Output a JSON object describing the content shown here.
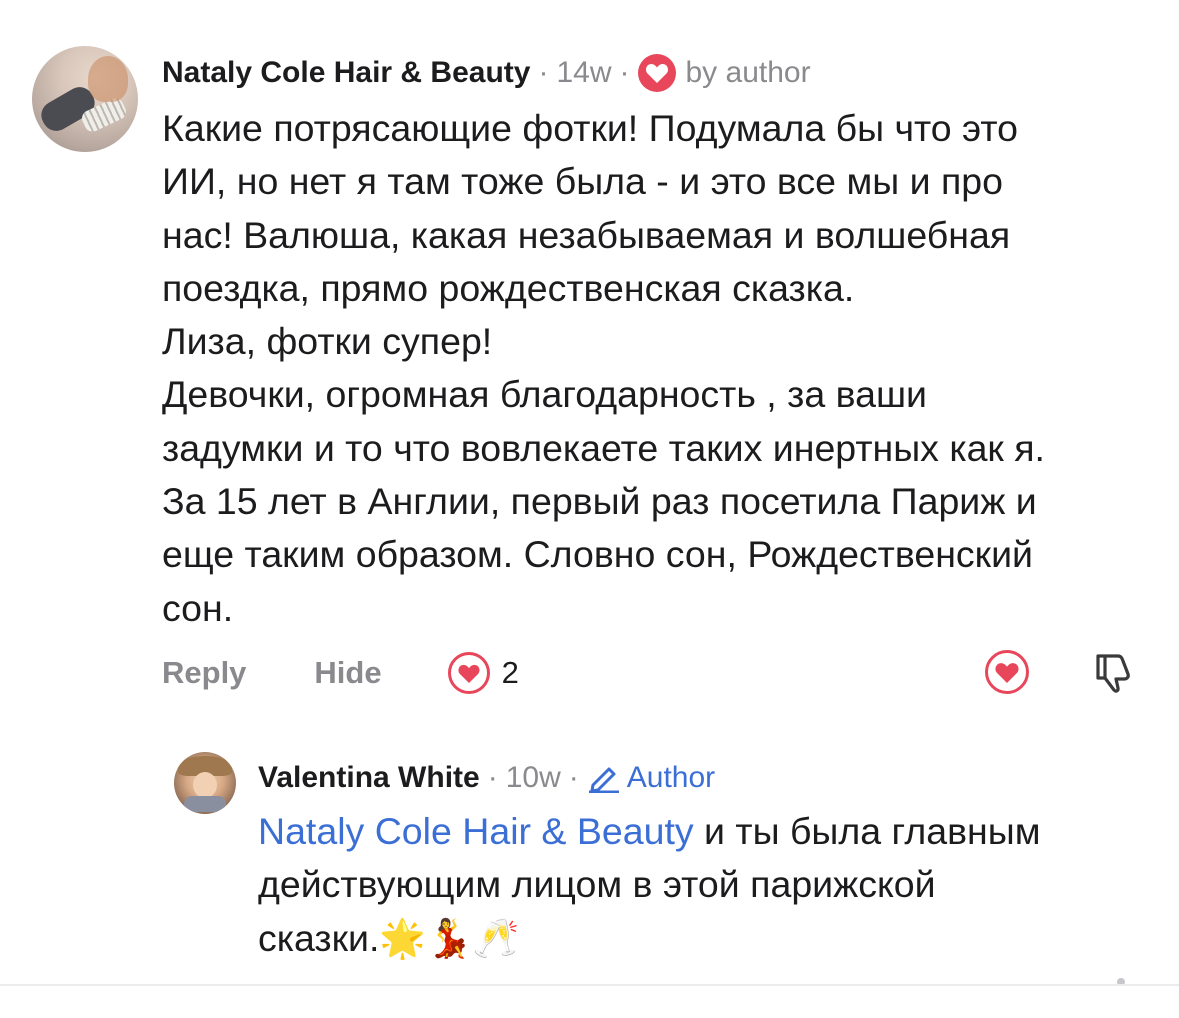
{
  "comment": {
    "author": "Nataly Cole Hair & Beauty",
    "time": "14w",
    "liked_by": "by author",
    "lines": [
      "Какие потрясающие фотки!  Подумала бы что это",
      "ИИ, но нет я там тоже была - и это все мы и про",
      "нас! Валюша, какая незабываемая и волшебная",
      "поездка, прямо рождественская сказка.",
      "Лиза, фотки супер!",
      "Девочки, огромная благодарность , за ваши",
      "задумки и то что вовлекаете таких инертных как я.",
      "За 15 лет в Англии, первый раз посетила Париж и",
      "еще таким образом. Словно сон, Рождественский",
      "сон."
    ],
    "actions": {
      "reply": "Reply",
      "hide": "Hide",
      "reaction_count": "2"
    }
  },
  "reply": {
    "author": "Valentina White",
    "time": "10w",
    "badge": "Author",
    "mention": "Nataly Cole Hair & Beauty",
    "line1_rest": " и ты была главным",
    "line2": "действующим лицом в этой парижской",
    "line3": "сказки.",
    "emojis": "🌟💃🥂"
  },
  "colors": {
    "heart": "#e8475b",
    "link": "#3b6fd6",
    "meta": "#8a8a8e"
  }
}
